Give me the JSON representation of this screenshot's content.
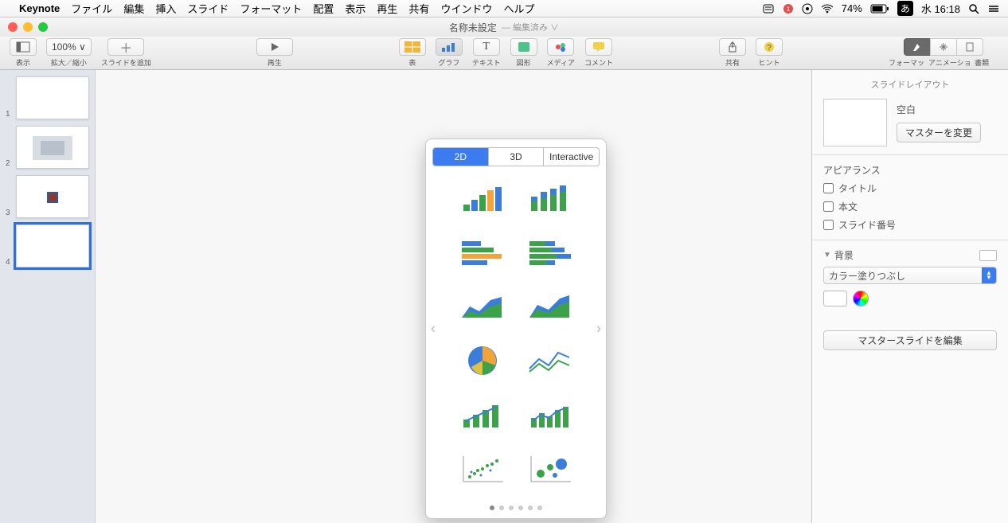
{
  "menubar": {
    "app": "Keynote",
    "items": [
      "ファイル",
      "編集",
      "挿入",
      "スライド",
      "フォーマット",
      "配置",
      "表示",
      "再生",
      "共有",
      "ウインドウ",
      "ヘルプ"
    ],
    "battery": "74%",
    "ime": "あ",
    "clock": "水 16:18"
  },
  "window": {
    "title": "名称未設定",
    "subtitle": "— 編集済み ∨"
  },
  "toolbar": {
    "view": "表示",
    "zoom": "100% ∨",
    "zoom_label": "拡大／縮小",
    "addslide": "スライドを追加",
    "play": "再生",
    "table": "表",
    "chart": "グラフ",
    "text": "テキスト",
    "shape": "図形",
    "media": "メディア",
    "comment": "コメント",
    "share": "共有",
    "tips": "ヒント",
    "format": "フォーマット",
    "animate": "アニメーション",
    "document": "書類"
  },
  "slides": [
    {
      "n": "1"
    },
    {
      "n": "2"
    },
    {
      "n": "3"
    },
    {
      "n": "4",
      "selected": true
    }
  ],
  "popover": {
    "tabs": [
      "2D",
      "3D",
      "Interactive"
    ],
    "selected": 0,
    "charts": [
      "bar",
      "stacked-bar",
      "hbar",
      "stacked-hbar",
      "area",
      "stacked-area",
      "pie",
      "line",
      "bar-trend",
      "mixed",
      "scatter",
      "bubble"
    ],
    "page": 1,
    "pages": 6
  },
  "inspector": {
    "header": "スライドレイアウト",
    "layout_name": "空白",
    "change_master": "マスターを変更",
    "appearance": "アピアランス",
    "cb_title": "タイトル",
    "cb_body": "本文",
    "cb_pageno": "スライド番号",
    "background": "背景",
    "fill_mode": "カラー塗りつぶし",
    "edit_master": "マスタースライドを編集"
  }
}
